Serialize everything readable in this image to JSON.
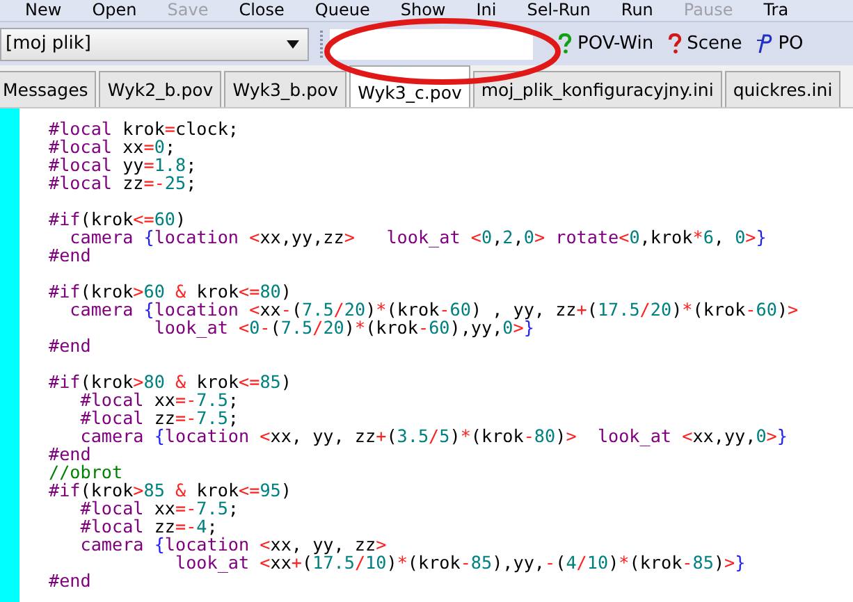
{
  "menu": [
    {
      "label": "New",
      "disabled": false
    },
    {
      "label": "Open",
      "disabled": false
    },
    {
      "label": "Save",
      "disabled": true
    },
    {
      "label": "Close",
      "disabled": false
    },
    {
      "label": "Queue",
      "disabled": false
    },
    {
      "label": "Show",
      "disabled": false
    },
    {
      "label": "Ini",
      "disabled": false
    },
    {
      "label": "Sel-Run",
      "disabled": false
    },
    {
      "label": "Run",
      "disabled": false
    },
    {
      "label": "Pause",
      "disabled": true
    },
    {
      "label": "Tra",
      "disabled": false
    }
  ],
  "toolbar": {
    "dropdown": {
      "value": "[moj plik]"
    },
    "buttons": [
      {
        "label": "POV-Win",
        "kind": "help-green"
      },
      {
        "label": "Scene",
        "kind": "help-red"
      },
      {
        "label": "PO",
        "kind": "pov"
      }
    ]
  },
  "tabs": [
    {
      "label": "Messages",
      "selected": false
    },
    {
      "label": "Wyk2_b.pov",
      "selected": false
    },
    {
      "label": "Wyk3_b.pov",
      "selected": false
    },
    {
      "label": "Wyk3_c.pov",
      "selected": true
    },
    {
      "label": "moj_plik_konfiguracyjny.ini",
      "selected": false
    },
    {
      "label": "quickres.ini",
      "selected": false
    }
  ],
  "code": [
    {
      "lines": [
        {
          "tokens": [
            {
              "kind": "d",
              "text": "#local"
            },
            {
              "kind": "t",
              "text": " krok"
            },
            {
              "kind": "o",
              "text": "="
            },
            {
              "kind": "t",
              "text": "clock;"
            }
          ]
        },
        {
          "tokens": [
            {
              "kind": "d",
              "text": "#local"
            },
            {
              "kind": "t",
              "text": " xx"
            },
            {
              "kind": "o",
              "text": "="
            },
            {
              "kind": "n",
              "text": "0"
            },
            {
              "kind": "t",
              "text": ";"
            }
          ]
        },
        {
          "tokens": [
            {
              "kind": "d",
              "text": "#local"
            },
            {
              "kind": "t",
              "text": " yy"
            },
            {
              "kind": "o",
              "text": "="
            },
            {
              "kind": "n",
              "text": "1.8"
            },
            {
              "kind": "t",
              "text": ";"
            }
          ]
        },
        {
          "tokens": [
            {
              "kind": "d",
              "text": "#local"
            },
            {
              "kind": "t",
              "text": " zz"
            },
            {
              "kind": "o",
              "text": "=-"
            },
            {
              "kind": "n",
              "text": "25"
            },
            {
              "kind": "t",
              "text": ";"
            }
          ]
        }
      ]
    },
    {
      "lines": [
        {
          "tokens": [
            {
              "kind": "d",
              "text": "#if"
            },
            {
              "kind": "t",
              "text": "(krok"
            },
            {
              "kind": "o",
              "text": "<="
            },
            {
              "kind": "n",
              "text": "60"
            },
            {
              "kind": "t",
              "text": ")"
            }
          ]
        },
        {
          "tokens": [
            {
              "kind": "d",
              "text": "  camera "
            },
            {
              "kind": "b",
              "text": "{"
            },
            {
              "kind": "d",
              "text": "location "
            },
            {
              "kind": "o",
              "text": "<"
            },
            {
              "kind": "t",
              "text": "xx,yy,zz"
            },
            {
              "kind": "o",
              "text": ">   "
            },
            {
              "kind": "d",
              "text": "look_at "
            },
            {
              "kind": "o",
              "text": "<"
            },
            {
              "kind": "n",
              "text": "0"
            },
            {
              "kind": "t",
              "text": ","
            },
            {
              "kind": "n",
              "text": "2"
            },
            {
              "kind": "t",
              "text": ","
            },
            {
              "kind": "n",
              "text": "0"
            },
            {
              "kind": "o",
              "text": "> "
            },
            {
              "kind": "d",
              "text": "rotate"
            },
            {
              "kind": "o",
              "text": "<"
            },
            {
              "kind": "n",
              "text": "0"
            },
            {
              "kind": "t",
              "text": ",krok"
            },
            {
              "kind": "o",
              "text": "*"
            },
            {
              "kind": "n",
              "text": "6"
            },
            {
              "kind": "t",
              "text": ", "
            },
            {
              "kind": "n",
              "text": "0"
            },
            {
              "kind": "o",
              "text": ">"
            },
            {
              "kind": "b",
              "text": "}"
            }
          ]
        },
        {
          "tokens": [
            {
              "kind": "d",
              "text": "#end"
            }
          ]
        }
      ]
    },
    {
      "lines": [
        {
          "tokens": [
            {
              "kind": "d",
              "text": "#if"
            },
            {
              "kind": "t",
              "text": "(krok"
            },
            {
              "kind": "o",
              "text": ">"
            },
            {
              "kind": "n",
              "text": "60 "
            },
            {
              "kind": "o",
              "text": "&"
            },
            {
              "kind": "t",
              "text": " krok"
            },
            {
              "kind": "o",
              "text": "<="
            },
            {
              "kind": "n",
              "text": "80"
            },
            {
              "kind": "t",
              "text": ")"
            }
          ]
        },
        {
          "tokens": [
            {
              "kind": "d",
              "text": "  camera "
            },
            {
              "kind": "b",
              "text": "{"
            },
            {
              "kind": "d",
              "text": "location "
            },
            {
              "kind": "o",
              "text": "<"
            },
            {
              "kind": "t",
              "text": "xx"
            },
            {
              "kind": "o",
              "text": "-"
            },
            {
              "kind": "t",
              "text": "("
            },
            {
              "kind": "n",
              "text": "7.5"
            },
            {
              "kind": "o",
              "text": "/"
            },
            {
              "kind": "n",
              "text": "20"
            },
            {
              "kind": "t",
              "text": ")"
            },
            {
              "kind": "o",
              "text": "*"
            },
            {
              "kind": "t",
              "text": "(krok"
            },
            {
              "kind": "o",
              "text": "-"
            },
            {
              "kind": "n",
              "text": "60"
            },
            {
              "kind": "t",
              "text": ") , yy, zz"
            },
            {
              "kind": "o",
              "text": "+"
            },
            {
              "kind": "t",
              "text": "("
            },
            {
              "kind": "n",
              "text": "17.5"
            },
            {
              "kind": "o",
              "text": "/"
            },
            {
              "kind": "n",
              "text": "20"
            },
            {
              "kind": "t",
              "text": ")"
            },
            {
              "kind": "o",
              "text": "*"
            },
            {
              "kind": "t",
              "text": "(krok"
            },
            {
              "kind": "o",
              "text": "-"
            },
            {
              "kind": "n",
              "text": "60"
            },
            {
              "kind": "t",
              "text": ")"
            },
            {
              "kind": "o",
              "text": ">"
            }
          ]
        },
        {
          "tokens": [
            {
              "kind": "d",
              "text": "          look_at "
            },
            {
              "kind": "o",
              "text": "<"
            },
            {
              "kind": "n",
              "text": "0"
            },
            {
              "kind": "o",
              "text": "-"
            },
            {
              "kind": "t",
              "text": "("
            },
            {
              "kind": "n",
              "text": "7.5"
            },
            {
              "kind": "o",
              "text": "/"
            },
            {
              "kind": "n",
              "text": "20"
            },
            {
              "kind": "t",
              "text": ")"
            },
            {
              "kind": "o",
              "text": "*"
            },
            {
              "kind": "t",
              "text": "(krok"
            },
            {
              "kind": "o",
              "text": "-"
            },
            {
              "kind": "n",
              "text": "60"
            },
            {
              "kind": "t",
              "text": "),yy,"
            },
            {
              "kind": "n",
              "text": "0"
            },
            {
              "kind": "o",
              "text": ">"
            },
            {
              "kind": "b",
              "text": "}"
            }
          ]
        },
        {
          "tokens": [
            {
              "kind": "d",
              "text": "#end"
            }
          ]
        }
      ]
    },
    {
      "lines": [
        {
          "tokens": [
            {
              "kind": "d",
              "text": "#if"
            },
            {
              "kind": "t",
              "text": "(krok"
            },
            {
              "kind": "o",
              "text": ">"
            },
            {
              "kind": "n",
              "text": "80 "
            },
            {
              "kind": "o",
              "text": "&"
            },
            {
              "kind": "t",
              "text": " krok"
            },
            {
              "kind": "o",
              "text": "<="
            },
            {
              "kind": "n",
              "text": "85"
            },
            {
              "kind": "t",
              "text": ")"
            }
          ]
        },
        {
          "tokens": [
            {
              "kind": "d",
              "text": "   #local"
            },
            {
              "kind": "t",
              "text": " xx"
            },
            {
              "kind": "o",
              "text": "=-"
            },
            {
              "kind": "n",
              "text": "7.5"
            },
            {
              "kind": "t",
              "text": ";"
            }
          ]
        },
        {
          "tokens": [
            {
              "kind": "d",
              "text": "   #local"
            },
            {
              "kind": "t",
              "text": " zz"
            },
            {
              "kind": "o",
              "text": "=-"
            },
            {
              "kind": "n",
              "text": "7.5"
            },
            {
              "kind": "t",
              "text": ";"
            }
          ]
        },
        {
          "tokens": [
            {
              "kind": "d",
              "text": "   camera "
            },
            {
              "kind": "b",
              "text": "{"
            },
            {
              "kind": "d",
              "text": "location "
            },
            {
              "kind": "o",
              "text": "<"
            },
            {
              "kind": "t",
              "text": "xx, yy, zz"
            },
            {
              "kind": "o",
              "text": "+"
            },
            {
              "kind": "t",
              "text": "("
            },
            {
              "kind": "n",
              "text": "3.5"
            },
            {
              "kind": "o",
              "text": "/"
            },
            {
              "kind": "n",
              "text": "5"
            },
            {
              "kind": "t",
              "text": ")"
            },
            {
              "kind": "o",
              "text": "*"
            },
            {
              "kind": "t",
              "text": "(krok"
            },
            {
              "kind": "o",
              "text": "-"
            },
            {
              "kind": "n",
              "text": "80"
            },
            {
              "kind": "t",
              "text": ")"
            },
            {
              "kind": "o",
              "text": ">  "
            },
            {
              "kind": "d",
              "text": "look_at "
            },
            {
              "kind": "o",
              "text": "<"
            },
            {
              "kind": "t",
              "text": "xx,yy,"
            },
            {
              "kind": "n",
              "text": "0"
            },
            {
              "kind": "o",
              "text": ">"
            },
            {
              "kind": "b",
              "text": "}"
            }
          ]
        },
        {
          "tokens": [
            {
              "kind": "d",
              "text": "#end"
            }
          ]
        },
        {
          "tokens": [
            {
              "kind": "c",
              "text": "//obrot"
            }
          ]
        },
        {
          "tokens": [
            {
              "kind": "d",
              "text": "#if"
            },
            {
              "kind": "t",
              "text": "(krok"
            },
            {
              "kind": "o",
              "text": ">"
            },
            {
              "kind": "n",
              "text": "85 "
            },
            {
              "kind": "o",
              "text": "&"
            },
            {
              "kind": "t",
              "text": " krok"
            },
            {
              "kind": "o",
              "text": "<="
            },
            {
              "kind": "n",
              "text": "95"
            },
            {
              "kind": "t",
              "text": ")"
            }
          ]
        },
        {
          "tokens": [
            {
              "kind": "d",
              "text": "   #local"
            },
            {
              "kind": "t",
              "text": " xx"
            },
            {
              "kind": "o",
              "text": "=-"
            },
            {
              "kind": "n",
              "text": "7.5"
            },
            {
              "kind": "t",
              "text": ";"
            }
          ]
        },
        {
          "tokens": [
            {
              "kind": "d",
              "text": "   #local"
            },
            {
              "kind": "t",
              "text": " zz"
            },
            {
              "kind": "o",
              "text": "=-"
            },
            {
              "kind": "n",
              "text": "4"
            },
            {
              "kind": "t",
              "text": ";"
            }
          ]
        },
        {
          "tokens": [
            {
              "kind": "d",
              "text": "   camera "
            },
            {
              "kind": "b",
              "text": "{"
            },
            {
              "kind": "d",
              "text": "location "
            },
            {
              "kind": "o",
              "text": "<"
            },
            {
              "kind": "t",
              "text": "xx, yy, zz"
            },
            {
              "kind": "o",
              "text": ">"
            }
          ]
        },
        {
          "tokens": [
            {
              "kind": "d",
              "text": "            look_at "
            },
            {
              "kind": "o",
              "text": "<"
            },
            {
              "kind": "t",
              "text": "xx"
            },
            {
              "kind": "o",
              "text": "+"
            },
            {
              "kind": "t",
              "text": "("
            },
            {
              "kind": "n",
              "text": "17.5"
            },
            {
              "kind": "o",
              "text": "/"
            },
            {
              "kind": "n",
              "text": "10"
            },
            {
              "kind": "t",
              "text": ")"
            },
            {
              "kind": "o",
              "text": "*"
            },
            {
              "kind": "t",
              "text": "(krok"
            },
            {
              "kind": "o",
              "text": "-"
            },
            {
              "kind": "n",
              "text": "85"
            },
            {
              "kind": "t",
              "text": "),yy,"
            },
            {
              "kind": "o",
              "text": "-"
            },
            {
              "kind": "t",
              "text": "("
            },
            {
              "kind": "n",
              "text": "4"
            },
            {
              "kind": "o",
              "text": "/"
            },
            {
              "kind": "n",
              "text": "10"
            },
            {
              "kind": "t",
              "text": ")"
            },
            {
              "kind": "o",
              "text": "*"
            },
            {
              "kind": "t",
              "text": "(krok"
            },
            {
              "kind": "o",
              "text": "-"
            },
            {
              "kind": "n",
              "text": "85"
            },
            {
              "kind": "t",
              "text": ")"
            },
            {
              "kind": "o",
              "text": ">"
            },
            {
              "kind": "b",
              "text": "}"
            }
          ]
        },
        {
          "tokens": [
            {
              "kind": "d",
              "text": "#end"
            }
          ]
        }
      ]
    }
  ]
}
